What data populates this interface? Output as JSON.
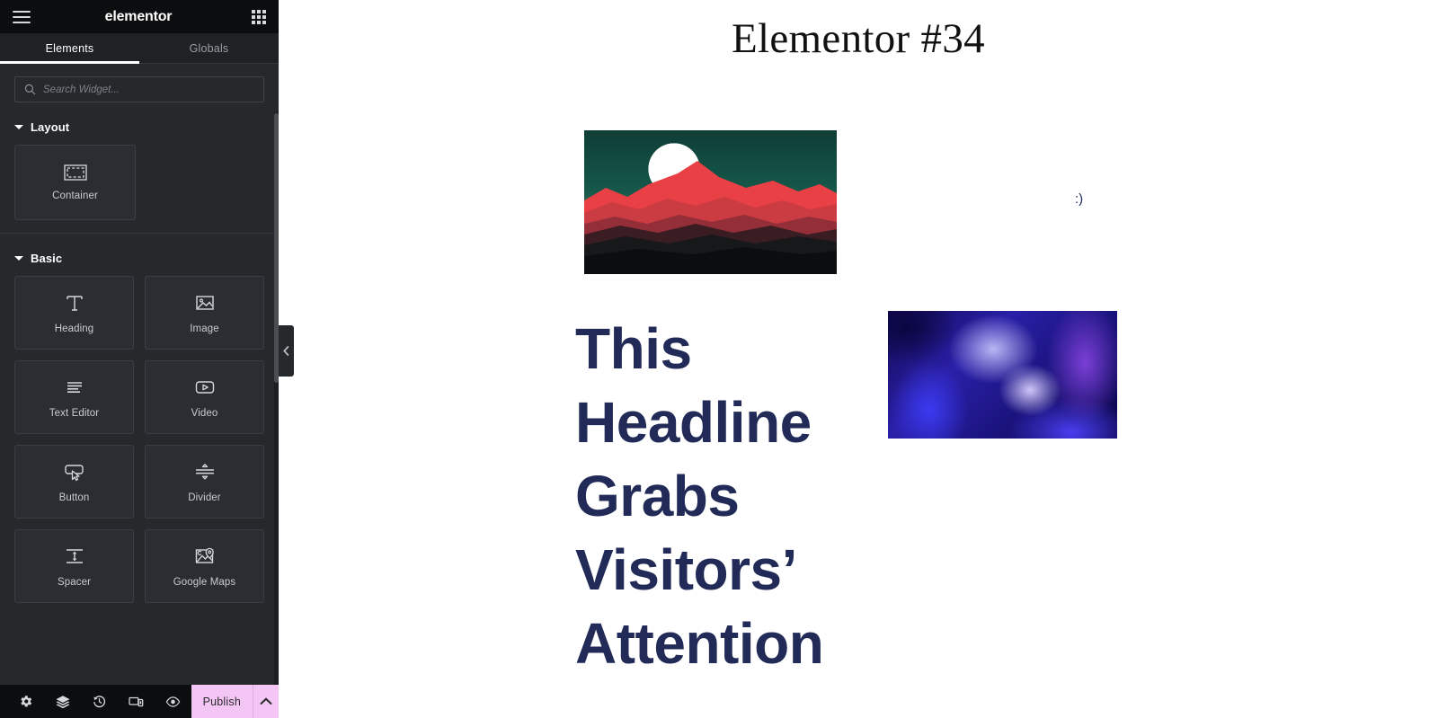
{
  "panel": {
    "header": {
      "brand": "elementor",
      "menu_icon": "hamburger-icon",
      "apps_icon": "apps-grid-icon"
    },
    "tabs": [
      {
        "label": "Elements",
        "active": true
      },
      {
        "label": "Globals",
        "active": false
      }
    ],
    "search": {
      "placeholder": "Search Widget...",
      "value": "",
      "icon": "search-icon"
    },
    "sections": [
      {
        "title": "Layout",
        "widgets": [
          {
            "label": "Container",
            "icon": "container-icon"
          }
        ]
      },
      {
        "title": "Basic",
        "widgets": [
          {
            "label": "Heading",
            "icon": "heading-icon"
          },
          {
            "label": "Image",
            "icon": "image-icon"
          },
          {
            "label": "Text Editor",
            "icon": "text-editor-icon"
          },
          {
            "label": "Video",
            "icon": "video-icon"
          },
          {
            "label": "Button",
            "icon": "button-icon"
          },
          {
            "label": "Divider",
            "icon": "divider-icon"
          },
          {
            "label": "Spacer",
            "icon": "spacer-icon"
          },
          {
            "label": "Google Maps",
            "icon": "google-maps-icon"
          }
        ]
      }
    ],
    "footer": {
      "icons": [
        {
          "name": "settings-gear-icon",
          "title": "Settings"
        },
        {
          "name": "navigator-layers-icon",
          "title": "Navigator"
        },
        {
          "name": "history-clock-icon",
          "title": "History"
        },
        {
          "name": "responsive-devices-icon",
          "title": "Responsive Mode"
        },
        {
          "name": "preview-eye-icon",
          "title": "Preview Changes"
        }
      ],
      "publish_label": "Publish",
      "publish_arrow_icon": "chevron-up-icon",
      "publish_color": "#f3c6f5"
    },
    "collapse_handle_icon": "chevron-left-icon"
  },
  "canvas": {
    "page_title": "Elementor #34",
    "smiley_text": ":)",
    "headline": "This Headline Grabs Visitors’ Attention",
    "headline_color": "#222b57",
    "images": [
      {
        "name": "mountain-sunset-image",
        "alt": "Red mountains with white moon over dark green sky"
      },
      {
        "name": "blue-gradient-image",
        "alt": "Abstract blue and purple fluid gradient"
      }
    ]
  }
}
